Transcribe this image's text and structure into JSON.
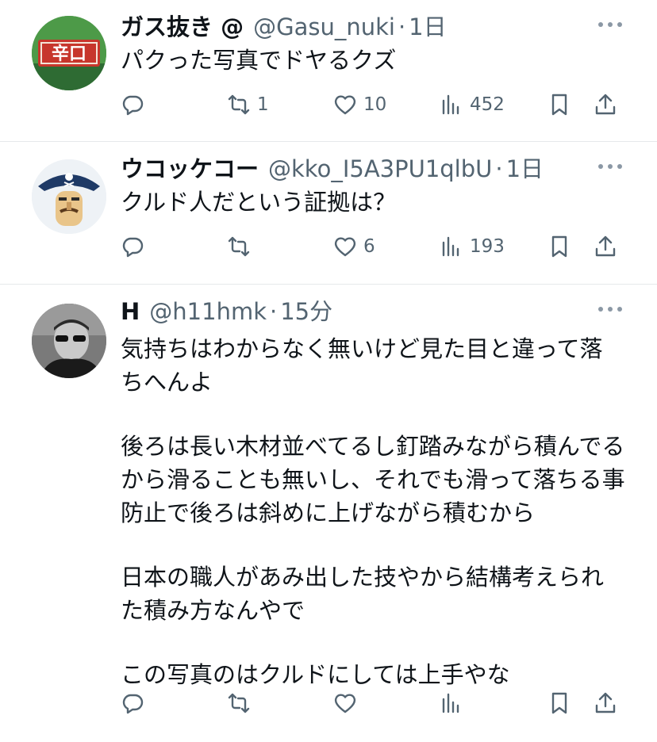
{
  "tweets": [
    {
      "name": "ガス抜き @",
      "handle": "@Gasu_nuki",
      "sep": "·",
      "time": "1日",
      "avatar_icon": "karakuchi-sign-avatar",
      "avatar_text": "辛口",
      "body": [
        "パクった写真でドヤるクズ"
      ],
      "reply_count": "",
      "retweet_count": "1",
      "like_count": "10",
      "view_count": "452"
    },
    {
      "name": "ウコッケコー",
      "handle": "@kko_I5A3PU1qlbU",
      "sep": "·",
      "time": "1日",
      "avatar_icon": "pirate-avatar",
      "body": [
        "クルド人だという証拠は？"
      ],
      "reply_count": "",
      "retweet_count": "",
      "like_count": "6",
      "view_count": "193"
    },
    {
      "name": "H",
      "handle": "@h11hmk",
      "sep": "·",
      "time": "15分",
      "avatar_icon": "sunglasses-man-avatar",
      "body": [
        "気持ちはわからなく無いけど見た目と違って落ちへんよ",
        "",
        "後ろは長い木材並べてるし釘踏みながら積んでるから滑ることも無いし、それでも滑って落ちる事防止で後ろは斜めに上げながら積むから",
        "",
        "日本の職人があみ出した技やから結構考えられた積み方なんやで",
        "",
        "この写真のはクルドにしては上手やな"
      ],
      "reply_count": "",
      "retweet_count": "",
      "like_count": "",
      "view_count": ""
    }
  ],
  "icons": {
    "reply": "reply-icon",
    "retweet": "retweet-icon",
    "like": "heart-icon",
    "views": "views-icon",
    "bookmark": "bookmark-icon",
    "share": "share-icon",
    "more": "more-icon"
  },
  "colors": {
    "text": "#0f1419",
    "secondary": "#536471",
    "divider": "#e6e9eb",
    "avatar1_bg": "#3c8a3e",
    "avatar1_sign": "#c8362b"
  }
}
